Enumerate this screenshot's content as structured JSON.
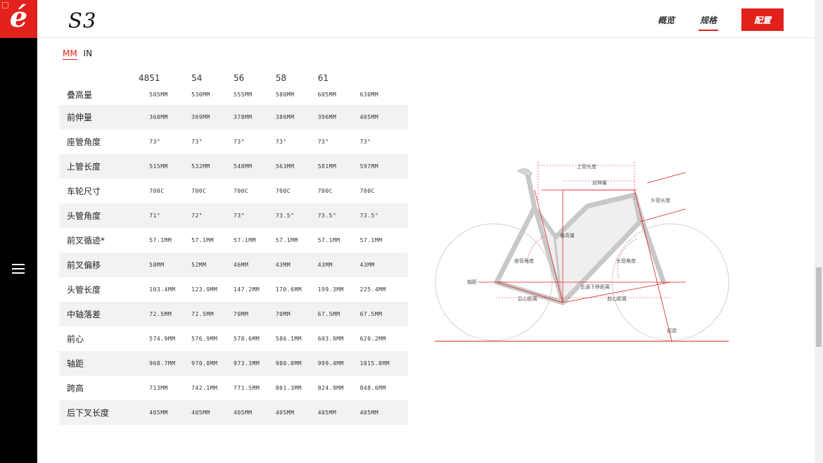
{
  "header": {
    "logo_glyph": "é",
    "model_name": "S3",
    "nav": {
      "overview": "概览",
      "specs": "规格",
      "configure": "配置"
    }
  },
  "units": {
    "mm": "MM",
    "in": "IN"
  },
  "sizes": [
    "48",
    "51",
    "54",
    "56",
    "58",
    "61"
  ],
  "rows": [
    {
      "label": "叠高量",
      "values": [
        "505MM",
        "530MM",
        "555MM",
        "580MM",
        "605MM",
        "630MM"
      ]
    },
    {
      "label": "前伸量",
      "values": [
        "360MM",
        "369MM",
        "378MM",
        "386MM",
        "396MM",
        "405MM"
      ]
    },
    {
      "label": "座管角度",
      "values": [
        "73°",
        "73°",
        "73°",
        "73°",
        "73°",
        "73°"
      ]
    },
    {
      "label": "上管长度",
      "values": [
        "515MM",
        "532MM",
        "548MM",
        "563MM",
        "581MM",
        "597MM"
      ]
    },
    {
      "label": "车轮尺寸",
      "values": [
        "700C",
        "700C",
        "700C",
        "700C",
        "700C",
        "700C"
      ]
    },
    {
      "label": "头管角度",
      "values": [
        "71°",
        "72°",
        "73°",
        "73.5°",
        "73.5°",
        "73.5°"
      ]
    },
    {
      "label": "前叉循迹*",
      "values": [
        "57.1MM",
        "57.1MM",
        "57.1MM",
        "57.1MM",
        "57.1MM",
        "57.1MM"
      ]
    },
    {
      "label": "前叉偏移",
      "values": [
        "58MM",
        "52MM",
        "46MM",
        "43MM",
        "43MM",
        "43MM"
      ]
    },
    {
      "label": "头管长度",
      "values": [
        "103.4MM",
        "123.9MM",
        "147.2MM",
        "170.6MM",
        "199.3MM",
        "225.4MM"
      ]
    },
    {
      "label": "中轴落差",
      "values": [
        "72.5MM",
        "72.5MM",
        "70MM",
        "70MM",
        "67.5MM",
        "67.5MM"
      ]
    },
    {
      "label": "前心",
      "values": [
        "574.9MM",
        "576.9MM",
        "578.6MM",
        "586.1MM",
        "603.9MM",
        "620.2MM"
      ]
    },
    {
      "label": "轴距",
      "values": [
        "968.7MM",
        "970.8MM",
        "973.3MM",
        "980.8MM",
        "999.4MM",
        "1015.8MM"
      ]
    },
    {
      "label": "跨高",
      "values": [
        "713MM",
        "742.1MM",
        "771.5MM",
        "801.3MM",
        "824.9MM",
        "848.6MM"
      ]
    },
    {
      "label": "后下叉长度",
      "values": [
        "405MM",
        "405MM",
        "405MM",
        "405MM",
        "405MM",
        "405MM"
      ]
    }
  ],
  "diagram_labels": {
    "top_tube": "上管长度",
    "reach": "前伸量",
    "head_tube_length": "头管长度",
    "stack": "叠高量",
    "seat_angle": "座管角度",
    "head_angle": "头管角度",
    "wheelbase": "轴距",
    "bb_drop": "五通下移距离",
    "rear_center": "后心距离",
    "front_center": "前心距离",
    "trail": "前迹"
  }
}
